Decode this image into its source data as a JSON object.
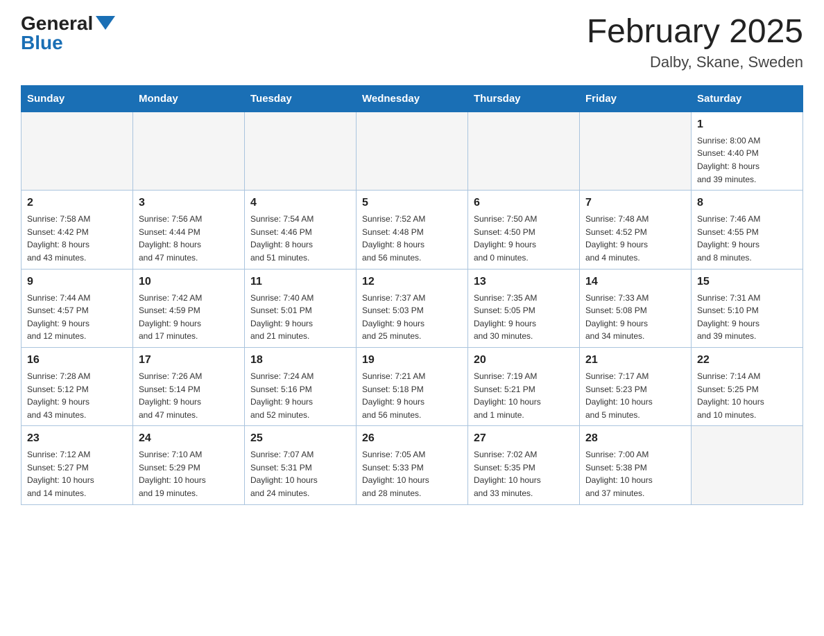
{
  "logo": {
    "general": "General",
    "blue": "Blue"
  },
  "title": "February 2025",
  "location": "Dalby, Skane, Sweden",
  "days_of_week": [
    "Sunday",
    "Monday",
    "Tuesday",
    "Wednesday",
    "Thursday",
    "Friday",
    "Saturday"
  ],
  "weeks": [
    [
      {
        "day": "",
        "info": ""
      },
      {
        "day": "",
        "info": ""
      },
      {
        "day": "",
        "info": ""
      },
      {
        "day": "",
        "info": ""
      },
      {
        "day": "",
        "info": ""
      },
      {
        "day": "",
        "info": ""
      },
      {
        "day": "1",
        "info": "Sunrise: 8:00 AM\nSunset: 4:40 PM\nDaylight: 8 hours\nand 39 minutes."
      }
    ],
    [
      {
        "day": "2",
        "info": "Sunrise: 7:58 AM\nSunset: 4:42 PM\nDaylight: 8 hours\nand 43 minutes."
      },
      {
        "day": "3",
        "info": "Sunrise: 7:56 AM\nSunset: 4:44 PM\nDaylight: 8 hours\nand 47 minutes."
      },
      {
        "day": "4",
        "info": "Sunrise: 7:54 AM\nSunset: 4:46 PM\nDaylight: 8 hours\nand 51 minutes."
      },
      {
        "day": "5",
        "info": "Sunrise: 7:52 AM\nSunset: 4:48 PM\nDaylight: 8 hours\nand 56 minutes."
      },
      {
        "day": "6",
        "info": "Sunrise: 7:50 AM\nSunset: 4:50 PM\nDaylight: 9 hours\nand 0 minutes."
      },
      {
        "day": "7",
        "info": "Sunrise: 7:48 AM\nSunset: 4:52 PM\nDaylight: 9 hours\nand 4 minutes."
      },
      {
        "day": "8",
        "info": "Sunrise: 7:46 AM\nSunset: 4:55 PM\nDaylight: 9 hours\nand 8 minutes."
      }
    ],
    [
      {
        "day": "9",
        "info": "Sunrise: 7:44 AM\nSunset: 4:57 PM\nDaylight: 9 hours\nand 12 minutes."
      },
      {
        "day": "10",
        "info": "Sunrise: 7:42 AM\nSunset: 4:59 PM\nDaylight: 9 hours\nand 17 minutes."
      },
      {
        "day": "11",
        "info": "Sunrise: 7:40 AM\nSunset: 5:01 PM\nDaylight: 9 hours\nand 21 minutes."
      },
      {
        "day": "12",
        "info": "Sunrise: 7:37 AM\nSunset: 5:03 PM\nDaylight: 9 hours\nand 25 minutes."
      },
      {
        "day": "13",
        "info": "Sunrise: 7:35 AM\nSunset: 5:05 PM\nDaylight: 9 hours\nand 30 minutes."
      },
      {
        "day": "14",
        "info": "Sunrise: 7:33 AM\nSunset: 5:08 PM\nDaylight: 9 hours\nand 34 minutes."
      },
      {
        "day": "15",
        "info": "Sunrise: 7:31 AM\nSunset: 5:10 PM\nDaylight: 9 hours\nand 39 minutes."
      }
    ],
    [
      {
        "day": "16",
        "info": "Sunrise: 7:28 AM\nSunset: 5:12 PM\nDaylight: 9 hours\nand 43 minutes."
      },
      {
        "day": "17",
        "info": "Sunrise: 7:26 AM\nSunset: 5:14 PM\nDaylight: 9 hours\nand 47 minutes."
      },
      {
        "day": "18",
        "info": "Sunrise: 7:24 AM\nSunset: 5:16 PM\nDaylight: 9 hours\nand 52 minutes."
      },
      {
        "day": "19",
        "info": "Sunrise: 7:21 AM\nSunset: 5:18 PM\nDaylight: 9 hours\nand 56 minutes."
      },
      {
        "day": "20",
        "info": "Sunrise: 7:19 AM\nSunset: 5:21 PM\nDaylight: 10 hours\nand 1 minute."
      },
      {
        "day": "21",
        "info": "Sunrise: 7:17 AM\nSunset: 5:23 PM\nDaylight: 10 hours\nand 5 minutes."
      },
      {
        "day": "22",
        "info": "Sunrise: 7:14 AM\nSunset: 5:25 PM\nDaylight: 10 hours\nand 10 minutes."
      }
    ],
    [
      {
        "day": "23",
        "info": "Sunrise: 7:12 AM\nSunset: 5:27 PM\nDaylight: 10 hours\nand 14 minutes."
      },
      {
        "day": "24",
        "info": "Sunrise: 7:10 AM\nSunset: 5:29 PM\nDaylight: 10 hours\nand 19 minutes."
      },
      {
        "day": "25",
        "info": "Sunrise: 7:07 AM\nSunset: 5:31 PM\nDaylight: 10 hours\nand 24 minutes."
      },
      {
        "day": "26",
        "info": "Sunrise: 7:05 AM\nSunset: 5:33 PM\nDaylight: 10 hours\nand 28 minutes."
      },
      {
        "day": "27",
        "info": "Sunrise: 7:02 AM\nSunset: 5:35 PM\nDaylight: 10 hours\nand 33 minutes."
      },
      {
        "day": "28",
        "info": "Sunrise: 7:00 AM\nSunset: 5:38 PM\nDaylight: 10 hours\nand 37 minutes."
      },
      {
        "day": "",
        "info": ""
      }
    ]
  ]
}
